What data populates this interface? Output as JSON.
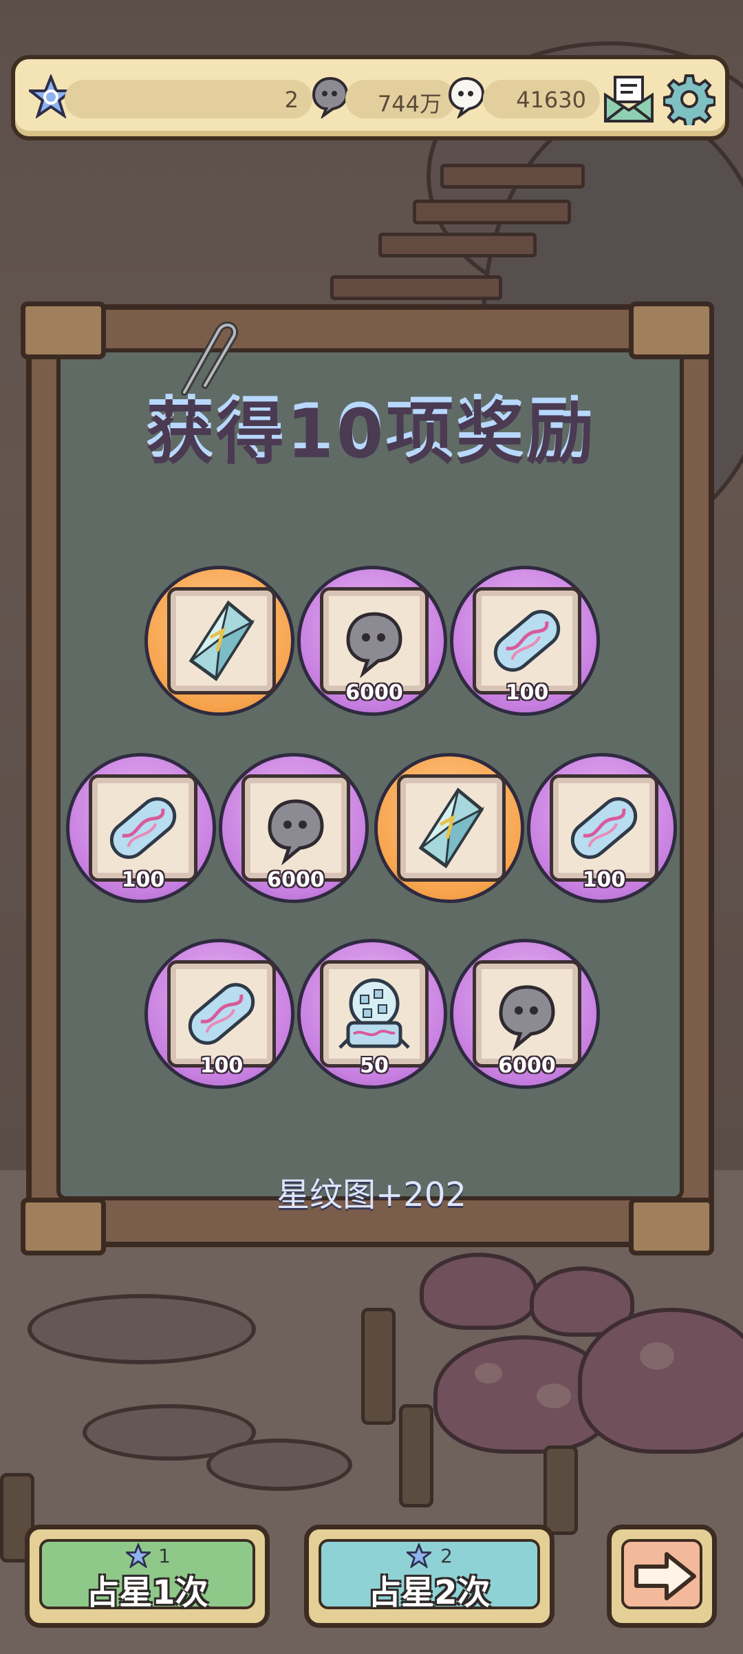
{
  "topbar": {
    "star_count": "2",
    "coins": "744万",
    "soul_count": "41630",
    "icons": [
      "star-level-icon",
      "gray-soul-icon",
      "white-soul-icon",
      "mail-icon",
      "gear-icon"
    ]
  },
  "modal": {
    "title": "获得10项奖励",
    "stat_text": "星纹图+202"
  },
  "rewards": [
    {
      "item": "crystal",
      "qty": "",
      "bg": "orange"
    },
    {
      "item": "gray-soul",
      "qty": "6000",
      "bg": "purple"
    },
    {
      "item": "capsule",
      "qty": "100",
      "bg": "purple"
    },
    {
      "item": "capsule",
      "qty": "100",
      "bg": "purple"
    },
    {
      "item": "gray-soul",
      "qty": "6000",
      "bg": "purple"
    },
    {
      "item": "crystal",
      "qty": "",
      "bg": "orange"
    },
    {
      "item": "capsule",
      "qty": "100",
      "bg": "purple"
    },
    {
      "item": "capsule",
      "qty": "100",
      "bg": "purple"
    },
    {
      "item": "crystal-ball",
      "qty": "50",
      "bg": "purple"
    },
    {
      "item": "gray-soul",
      "qty": "6000",
      "bg": "purple"
    }
  ],
  "buttons": {
    "draw_one": {
      "cost": "1",
      "label": "占星1次",
      "color": "#8fc98a"
    },
    "draw_two": {
      "cost": "2",
      "label": "占星2次",
      "color": "#8fd2d6"
    },
    "next": {
      "icon": "arrow-right-icon",
      "color": "#f2b99a"
    }
  }
}
